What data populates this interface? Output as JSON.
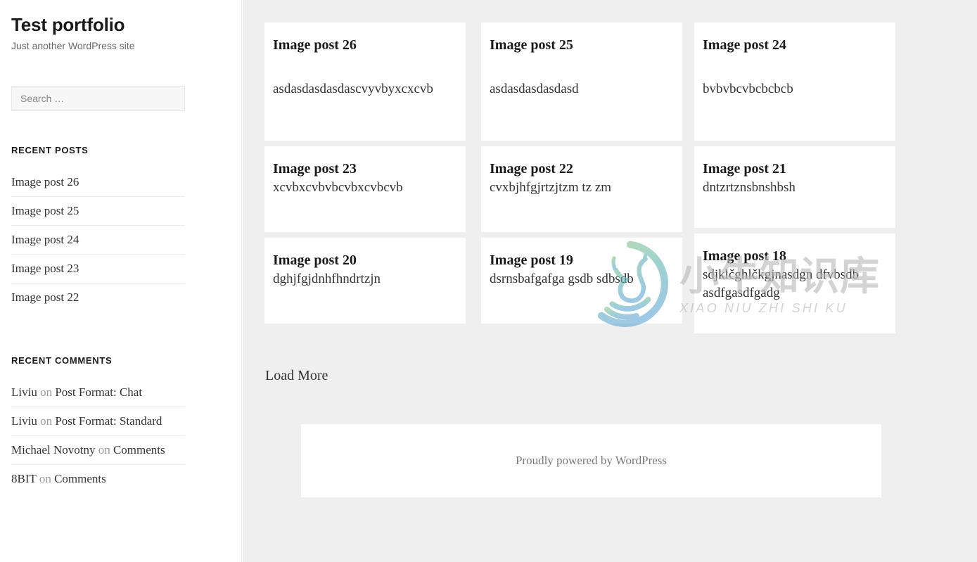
{
  "site": {
    "title": "Test portfolio",
    "description": "Just another WordPress site"
  },
  "search": {
    "placeholder": "Search …",
    "value": ""
  },
  "widgets": {
    "recent_posts": {
      "title": "Recent Posts",
      "items": [
        "Image post 26",
        "Image post 25",
        "Image post 24",
        "Image post 23",
        "Image post 22"
      ]
    },
    "recent_comments": {
      "title": "Recent Comments",
      "items": [
        {
          "author": "Liviu",
          "on": "on",
          "post": "Post Format: Chat"
        },
        {
          "author": "Liviu",
          "on": "on",
          "post": "Post Format: Standard"
        },
        {
          "author": "Michael Novotny",
          "on": "on",
          "post": "Comments"
        },
        {
          "author": "8BIT",
          "on": "on",
          "post": "Comments"
        }
      ]
    }
  },
  "grid": {
    "columns": [
      {
        "cards": [
          {
            "title": "Image post 26",
            "excerpt": "asdasdasdasdascvyvbyxcxcvb"
          },
          {
            "title": "Image post 23",
            "excerpt": "xcvbxcvbvbcvbxcvbcvb"
          },
          {
            "title": "Image post 20",
            "excerpt": "dghjfgjdnhfhndrtzjn"
          }
        ]
      },
      {
        "cards": [
          {
            "title": "Image post 25",
            "excerpt": "asdasdasdasdasd"
          },
          {
            "title": "Image post 22",
            "excerpt": "cvxbjhfgjrtzjtzm tz zm"
          },
          {
            "title": "Image post 19",
            "excerpt": "dsrnsbafgafga gsdb sdbsdb"
          }
        ]
      },
      {
        "cards": [
          {
            "title": "Image post 24",
            "excerpt": "bvbvbcvbcbcbcb"
          },
          {
            "title": "Image post 21",
            "excerpt": "dntzrtznsbnshbsh"
          },
          {
            "title": "Image post 18",
            "excerpt": "sdjklčghlčkgjnasdgn dfvbsdb asdfgasdfgadg"
          }
        ]
      }
    ],
    "load_more_label": "Load More"
  },
  "footer": {
    "credit_prefix": "Proudly powered by ",
    "credit_link": "WordPress"
  },
  "watermark": {
    "chinese": "小牛知识库",
    "pinyin": "XIAO NIU ZHI SHI KU",
    "gradient_start": "#4cae4c",
    "gradient_end": "#2f86c5"
  },
  "colors": {
    "page_background": "#ffffff",
    "main_background": "#efefef",
    "card_background": "#ffffff",
    "text_primary": "#1a1a1a",
    "text_secondary": "#686868",
    "divider": "#eaeaea"
  }
}
